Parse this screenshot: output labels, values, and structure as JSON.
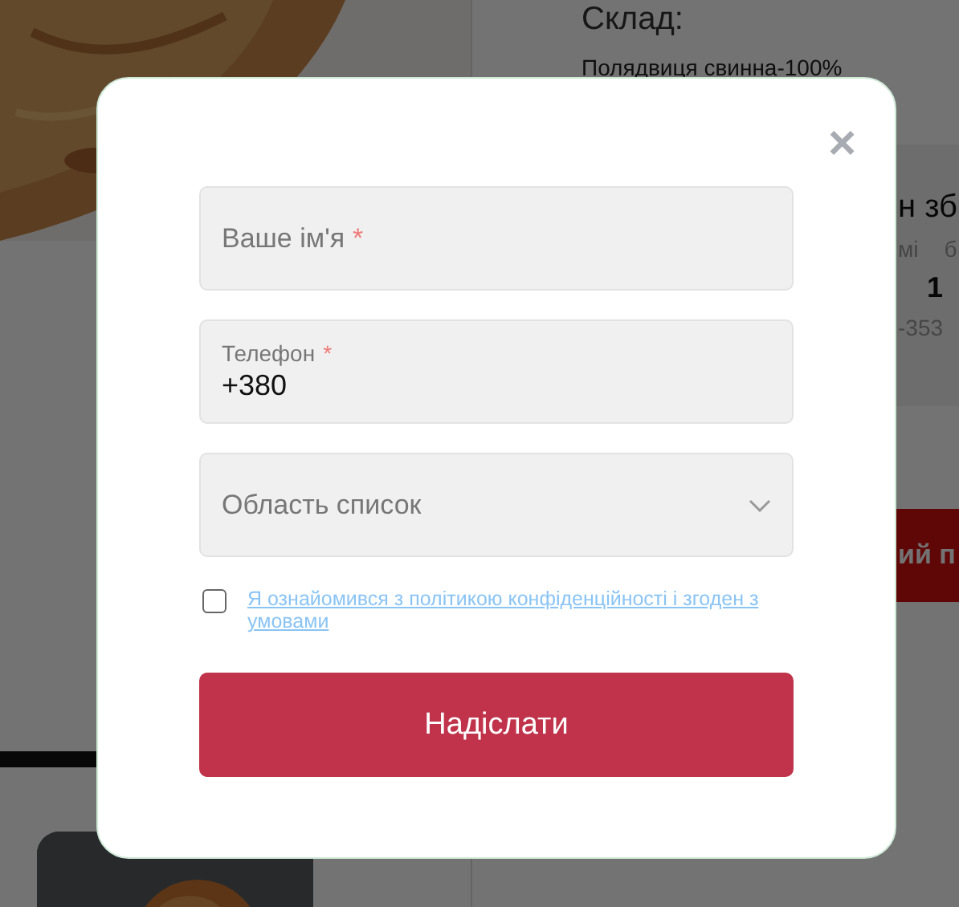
{
  "background": {
    "heading": "Склад:",
    "ingredients": "Полядвиця свинна-100%",
    "panel": {
      "title": "н зб",
      "column_1": "мі",
      "column_2": "б",
      "value": "1",
      "phone": "-353"
    },
    "action_button": "ий п"
  },
  "modal": {
    "close": "×",
    "fields": [
      {
        "kind": "text",
        "placeholder": "Ваше ім'я",
        "mark": "*"
      },
      {
        "kind": "phone",
        "label": "Телефон",
        "mark": "*",
        "value": "+380"
      },
      {
        "kind": "select",
        "placeholder": "Область список"
      }
    ],
    "consent": {
      "checked": false,
      "text": "Я ознайомився з політикою конфіденційності і згоден з умовами"
    },
    "submit": "Надіслати"
  }
}
